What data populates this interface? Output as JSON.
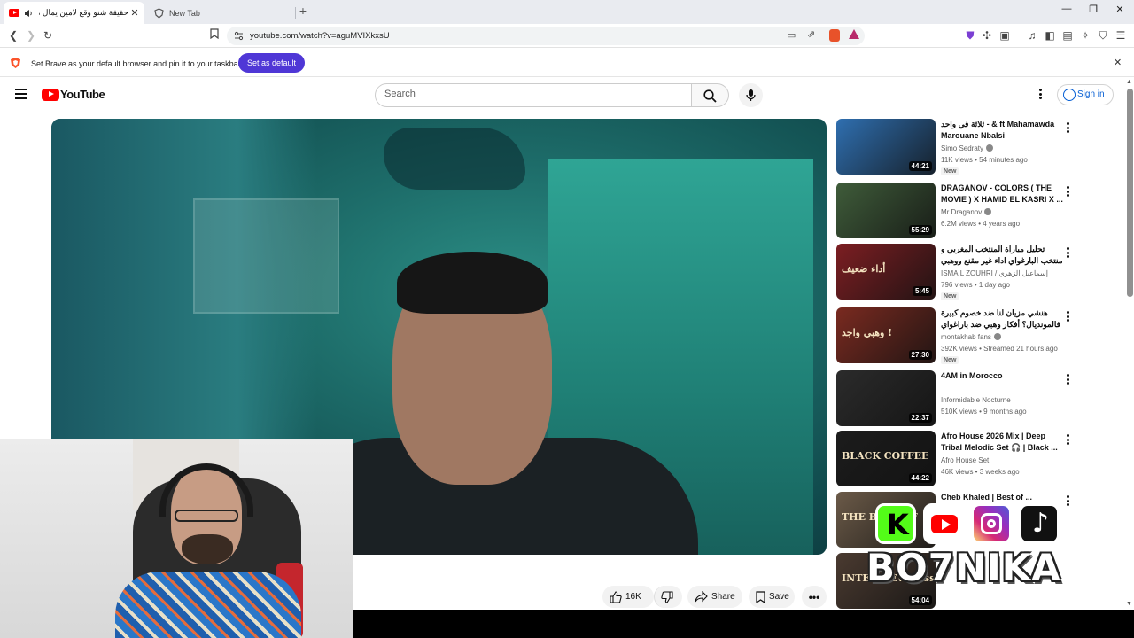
{
  "browser": {
    "tabs": [
      {
        "title": "حقيقة شنو وقع لامين يمال مع",
        "active": true
      },
      {
        "title": "New Tab",
        "active": false
      }
    ],
    "url": "youtube.com/watch?v=aguMVIXkxsU",
    "infobar": {
      "message": "Set Brave as your default browser and pin it to your taskbar",
      "button": "Set as default"
    }
  },
  "youtube": {
    "logo_text": "YouTube",
    "search_placeholder": "Search",
    "signin_label": "Sign in"
  },
  "actions": {
    "like_count": "16K",
    "share_label": "Share",
    "save_label": "Save"
  },
  "recommendations": [
    {
      "title": "ثلاثة في واحد - & ft Mahamawda Marouane Nbalsi",
      "channel": "Simo Sedraty",
      "verified": true,
      "meta": "11K views • 54 minutes ago",
      "badge": "New",
      "duration": "44:21",
      "thumb_color": "#2f6fb0"
    },
    {
      "title": "DRAGANOV - COLORS ( THE MOVIE ) X HAMID EL KASRI X ...",
      "channel": "Mr Draganov",
      "verified": true,
      "meta": "6.2M views • 4 years ago",
      "badge": "",
      "duration": "55:29",
      "thumb_color": "#3f5c3a"
    },
    {
      "title": "تحليل مباراة المنتخب المغربي و منتخب البارغواي اداء غير مقنع ووهبي ينتقد لتكتيكة وهبي",
      "channel": "ISMAIL ZOUHRI / إسماعيل الزهري",
      "verified": false,
      "meta": "796 views • 1 day ago",
      "badge": "New",
      "duration": "5:45",
      "thumb_color": "#7c1e22",
      "thumb_text": "أداء ضعيف"
    },
    {
      "title": "هنشي مزيان لنا ضد خصوم كبيرة فالمونديال؟ أفكار وهبي ضد باراغواي",
      "channel": "montakhab fans",
      "verified": true,
      "meta": "392K views • Streamed 21 hours ago",
      "badge": "New",
      "duration": "27:30",
      "thumb_color": "#7a2a20",
      "thumb_text": "وهبي واجد !"
    },
    {
      "title": "4AM in Morocco",
      "channel": "Informidable Nocturne",
      "verified": false,
      "meta": "510K views • 9 months ago",
      "badge": "",
      "duration": "22:37",
      "thumb_color": "#2b2b2b"
    },
    {
      "title": "Afro House 2026 Mix | Deep Tribal Melodic Set 🎧 | Black ...",
      "channel": "Afro House Set",
      "verified": false,
      "meta": "46K views • 3 weeks ago",
      "badge": "",
      "duration": "44:22",
      "thumb_color": "#1c1c1c",
      "thumb_text": "BLACK COFFEE"
    },
    {
      "title": "Cheb Khaled | Best of ...",
      "channel": "",
      "verified": false,
      "meta": "",
      "badge": "",
      "duration": "",
      "thumb_color": "#6b5a48",
      "thumb_text": "THE BEST OF"
    },
    {
      "title": "",
      "channel": "",
      "verified": false,
      "meta": "",
      "badge": "",
      "duration": "54:04",
      "thumb_color": "#4a3a30",
      "thumb_text": "INTERVIEW Yassine Bounou"
    }
  ],
  "overlay": {
    "text": "BO7NIKA",
    "colors": {
      "kick": "#53fc18",
      "youtube": "#ff0000",
      "instagram": "#d6249f",
      "tiktok": "#111111"
    }
  }
}
